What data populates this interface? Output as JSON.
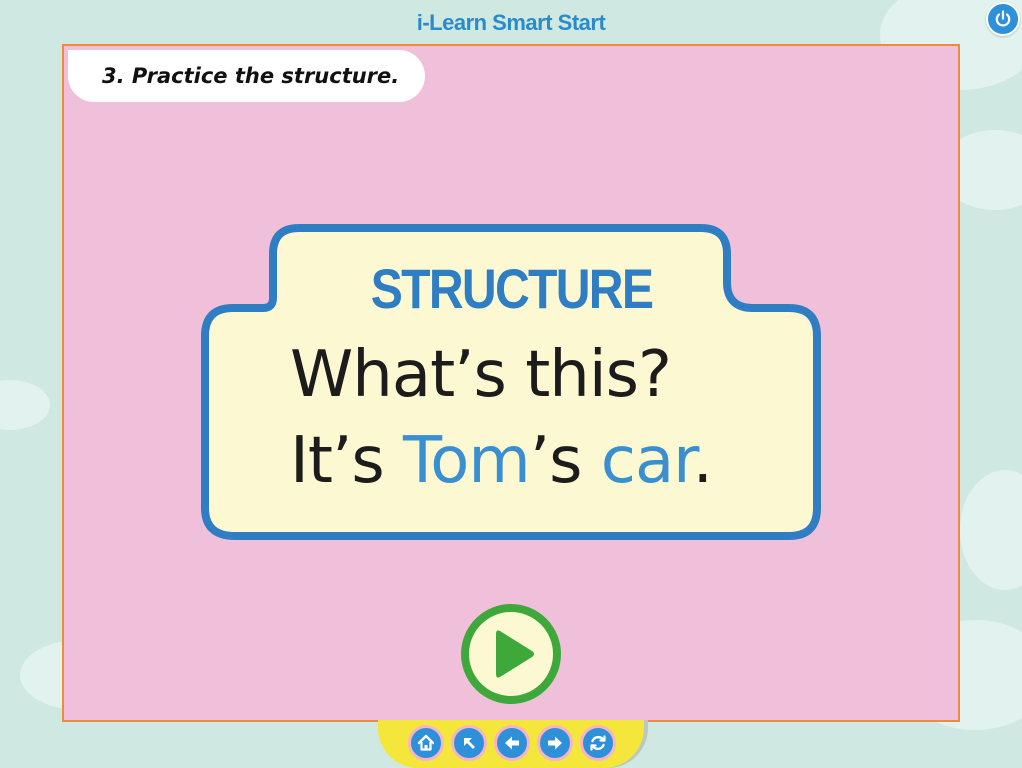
{
  "app": {
    "title": "i-Learn Smart Start"
  },
  "instruction": {
    "text": "3. Practice the structure."
  },
  "card": {
    "heading": "STRUCTURE",
    "question": "What’s this?",
    "answer_prefix": "It’s ",
    "answer_highlight_1": "Tom",
    "answer_mid": "’s ",
    "answer_highlight_2": "car",
    "answer_suffix": "."
  },
  "controls": {
    "power": {
      "icon": "power-icon"
    },
    "play": {
      "icon": "play-icon"
    },
    "nav": [
      {
        "name": "home",
        "icon": "home-icon"
      },
      {
        "name": "up",
        "icon": "arrow-up-left-icon"
      },
      {
        "name": "back",
        "icon": "arrow-left-icon"
      },
      {
        "name": "next",
        "icon": "arrow-right-icon"
      },
      {
        "name": "refresh",
        "icon": "refresh-icon"
      }
    ]
  },
  "colors": {
    "background": "#cfe9e2",
    "panel": "#f0bfd9",
    "panel_border": "#f08a3c",
    "card_fill": "#fcf9d2",
    "card_border": "#2f7ec4",
    "accent_blue": "#2f90da",
    "play_green": "#3ea93a",
    "nav_bar": "#f4e63a"
  }
}
